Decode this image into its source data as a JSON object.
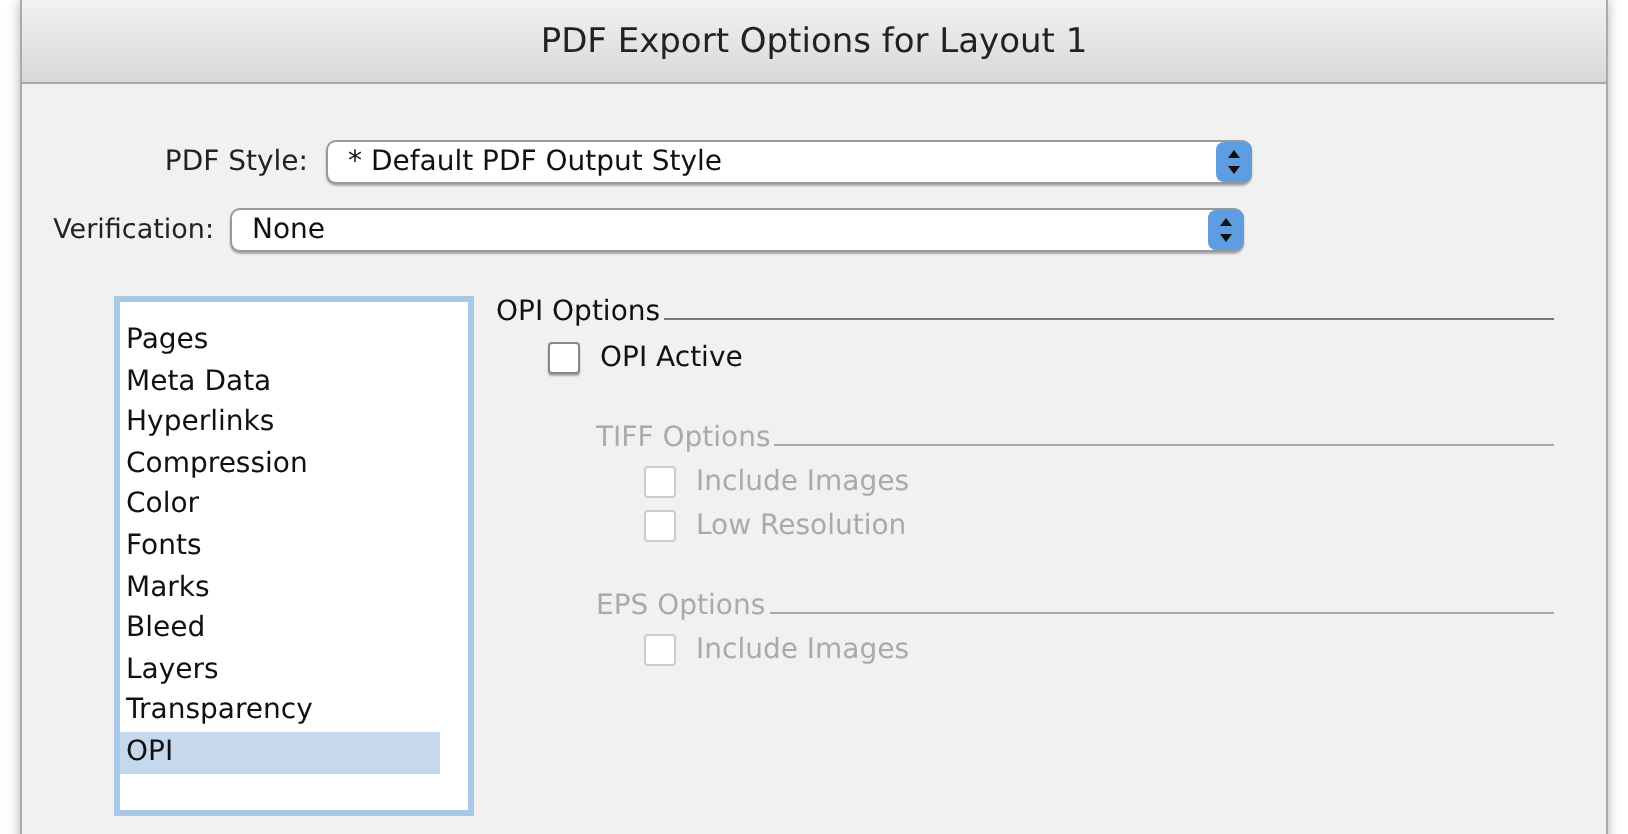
{
  "window": {
    "title": "PDF Export Options for Layout 1"
  },
  "fields": [
    {
      "label": "PDF Style:",
      "value": "* Default PDF Output Style",
      "kind": "short"
    },
    {
      "label": "Verification:",
      "value": "None",
      "kind": "long"
    }
  ],
  "sidebar": {
    "items": [
      {
        "label": "Pages",
        "selected": false
      },
      {
        "label": "Meta Data",
        "selected": false
      },
      {
        "label": "Hyperlinks",
        "selected": false
      },
      {
        "label": "Compression",
        "selected": false
      },
      {
        "label": "Color",
        "selected": false
      },
      {
        "label": "Fonts",
        "selected": false
      },
      {
        "label": "Marks",
        "selected": false
      },
      {
        "label": "Bleed",
        "selected": false
      },
      {
        "label": "Layers",
        "selected": false
      },
      {
        "label": "Transparency",
        "selected": false
      },
      {
        "label": "OPI",
        "selected": true
      }
    ]
  },
  "panel": {
    "title": "OPI Options",
    "active": {
      "label": "OPI Active",
      "checked": false,
      "disabled": false
    },
    "groups": [
      {
        "title": "TIFF Options",
        "disabled": true,
        "options": [
          {
            "label": "Include Images",
            "checked": false,
            "disabled": true
          },
          {
            "label": "Low Resolution",
            "checked": false,
            "disabled": true
          }
        ]
      },
      {
        "title": "EPS Options",
        "disabled": true,
        "options": [
          {
            "label": "Include Images",
            "checked": false,
            "disabled": true
          }
        ]
      }
    ]
  }
}
